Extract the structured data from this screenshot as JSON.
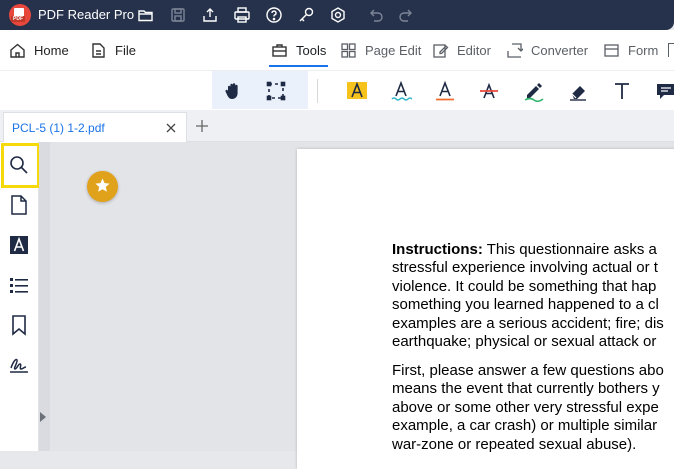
{
  "app": {
    "title": "PDF Reader Pro",
    "logo_label": "PDF",
    "accent_color": "#1a73e8",
    "titlebar_color": "#26324b"
  },
  "titlebar_icons": [
    "open-folder-icon",
    "save-icon",
    "share-icon",
    "print-icon",
    "help-icon",
    "key-icon",
    "settings-icon",
    "undo-icon",
    "redo-icon"
  ],
  "menu": {
    "home": "Home",
    "file": "File",
    "tools": "Tools",
    "page_edit": "Page Edit",
    "editor": "Editor",
    "converter": "Converter",
    "form": "Form"
  },
  "toolbar_icons": [
    "hand-icon",
    "marquee-select-icon",
    "highlight-text-icon",
    "squiggly-text-icon",
    "underline-text-icon",
    "strikethrough-text-icon",
    "freehand-pen-icon",
    "eraser-icon",
    "text-box-icon",
    "note-icon"
  ],
  "tab": {
    "title": "PCL-5 (1) 1-2.pdf"
  },
  "sidebar_icons": [
    "search-icon",
    "thumbnail-page-icon",
    "annotation-text-icon",
    "outline-list-icon",
    "bookmark-icon",
    "signature-icon"
  ],
  "document": {
    "para1_label": "Instructions:",
    "para1_lines": [
      " This questionnaire asks a",
      "stressful experience involving actual or t",
      "violence. It could be something that hap",
      "something you learned happened to a cl",
      "examples are a serious accident; fire; dis",
      "earthquake; physical or sexual attack or"
    ],
    "para2_lines": [
      "First, please answer a few questions abo",
      "means the event that currently bothers y",
      "above or some other very stressful expe",
      "example, a car crash) or multiple similar",
      "war-zone or repeated sexual abuse)."
    ]
  }
}
